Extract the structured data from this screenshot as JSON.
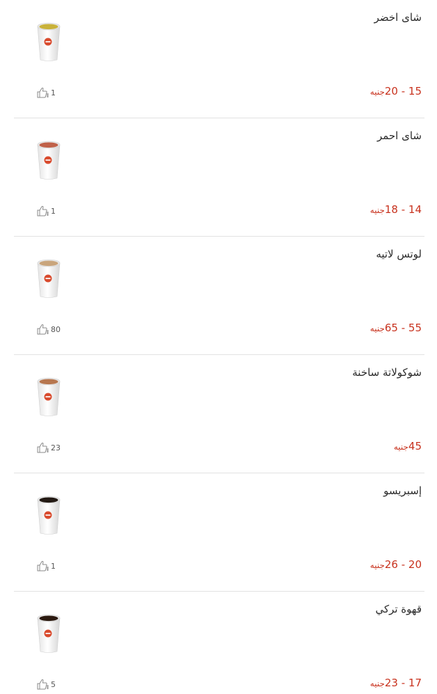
{
  "currency": "جنيه",
  "items": [
    {
      "name": "شاى اخضر",
      "price": "15 - 20",
      "likes": "1",
      "drink_color": "#c9b23a"
    },
    {
      "name": "شاى احمر",
      "price": "14 - 18",
      "likes": "1",
      "drink_color": "#c0624a"
    },
    {
      "name": "لوتس لاتيه",
      "price": "55 - 65",
      "likes": "80",
      "drink_color": "#c9a57c"
    },
    {
      "name": "شوكولاتة ساخنة",
      "price": "45",
      "likes": "23",
      "drink_color": "#b7774f"
    },
    {
      "name": "إسبريسو",
      "price": "20 - 26",
      "likes": "1",
      "drink_color": "#231a14"
    },
    {
      "name": "قهوة تركي",
      "price": "17 - 23",
      "likes": "5",
      "drink_color": "#2c1a10"
    }
  ],
  "colors": {
    "price": "#c8321e",
    "cup_badge": "#d94b2e",
    "divider": "#e2e2e2"
  }
}
